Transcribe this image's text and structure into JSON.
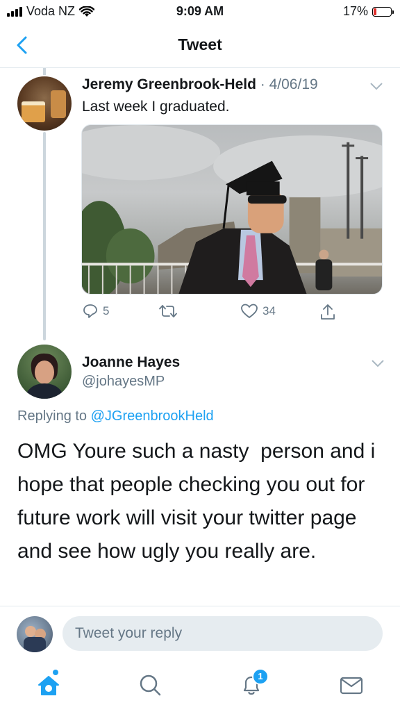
{
  "status_bar": {
    "carrier": "Voda NZ",
    "time": "9:09 AM",
    "battery_percent": "17%",
    "battery_level": 0.17
  },
  "nav": {
    "title": "Tweet",
    "back_icon": "chevron-left-icon"
  },
  "original_tweet": {
    "author_name": "Jeremy Greenbrook-Held",
    "date": "· 4/06/19",
    "text": "Last week I graduated.",
    "replies": "5",
    "likes": "34",
    "icons": [
      "reply-icon",
      "retweet-icon",
      "like-icon",
      "share-icon"
    ]
  },
  "reply_tweet": {
    "author_name": "Joanne Hayes",
    "handle": "@johayesMP",
    "replying_to_prefix": "Replying to ",
    "replying_to_mention": "@JGreenbrookHeld",
    "text": "OMG Youre such a nasty  person and i hope that people checking you out for future work will visit your twitter page and see how ugly you really are."
  },
  "reply_bar": {
    "placeholder": "Tweet your reply"
  },
  "tab_bar": {
    "tabs": [
      "home-icon",
      "search-icon",
      "notifications-icon",
      "messages-icon"
    ],
    "notifications_count": "1"
  },
  "colors": {
    "accent": "#1da1f2",
    "secondary_text": "#657786",
    "divider": "#e1e8ed",
    "battery_low": "#e0302c"
  }
}
